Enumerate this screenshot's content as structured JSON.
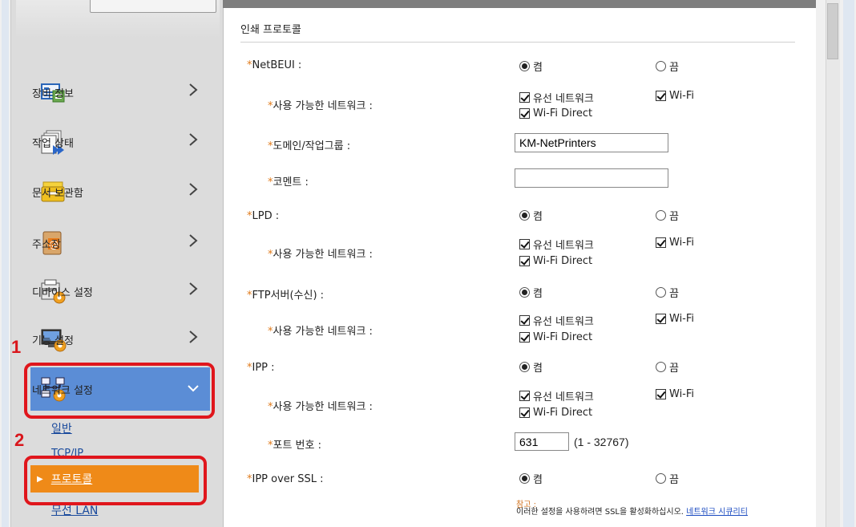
{
  "sidebar": {
    "items": [
      {
        "label": "장비 정보",
        "icon": "device-info-icon"
      },
      {
        "label": "작업 상태",
        "icon": "job-status-icon"
      },
      {
        "label": "문서 보관함",
        "icon": "document-box-icon"
      },
      {
        "label": "주소장",
        "icon": "address-book-icon"
      },
      {
        "label": "디바이스 설정",
        "icon": "device-settings-icon"
      },
      {
        "label": "기능 설정",
        "icon": "function-settings-icon"
      },
      {
        "label": "네트워크 설정",
        "icon": "network-settings-icon"
      }
    ],
    "subitems": {
      "general": "일반",
      "tcpip": "TCP/IP",
      "protocol": "프로토콜",
      "wireless": "무선 LAN"
    }
  },
  "callouts": {
    "step1": "1",
    "step2": "2"
  },
  "main": {
    "section_title": "인쇄 프로토콜",
    "req_mark": "*",
    "on_label": "켬",
    "off_label": "끔",
    "network_label": "사용 가능한 네트워크 :",
    "wired": "유선 네트워크",
    "wifi": "Wi-Fi",
    "wifi_direct": "Wi-Fi Direct",
    "netbeui": "NetBEUI :",
    "domain_label": "도메인/작업그룹 :",
    "domain_value": "KM-NetPrinters",
    "comment_label": "코멘트 :",
    "comment_value": "",
    "lpd": "LPD :",
    "ftp": "FTP서버(수신) :",
    "ipp": "IPP :",
    "port_label": "포트 번호 :",
    "port_value": "631",
    "port_range": "(1 - 32767)",
    "ipp_ssl": "IPP over SSL :",
    "note_title": "참고 :",
    "note_text": "이러한 설정을 사용하려면 SSL을 활성화하십시오.",
    "note_link": "네트워크 시큐리티"
  },
  "colors": {
    "accent": "#5b8dd6",
    "selected": "#ef8a18",
    "callout": "#e0161c",
    "link": "#1a4a9c"
  }
}
